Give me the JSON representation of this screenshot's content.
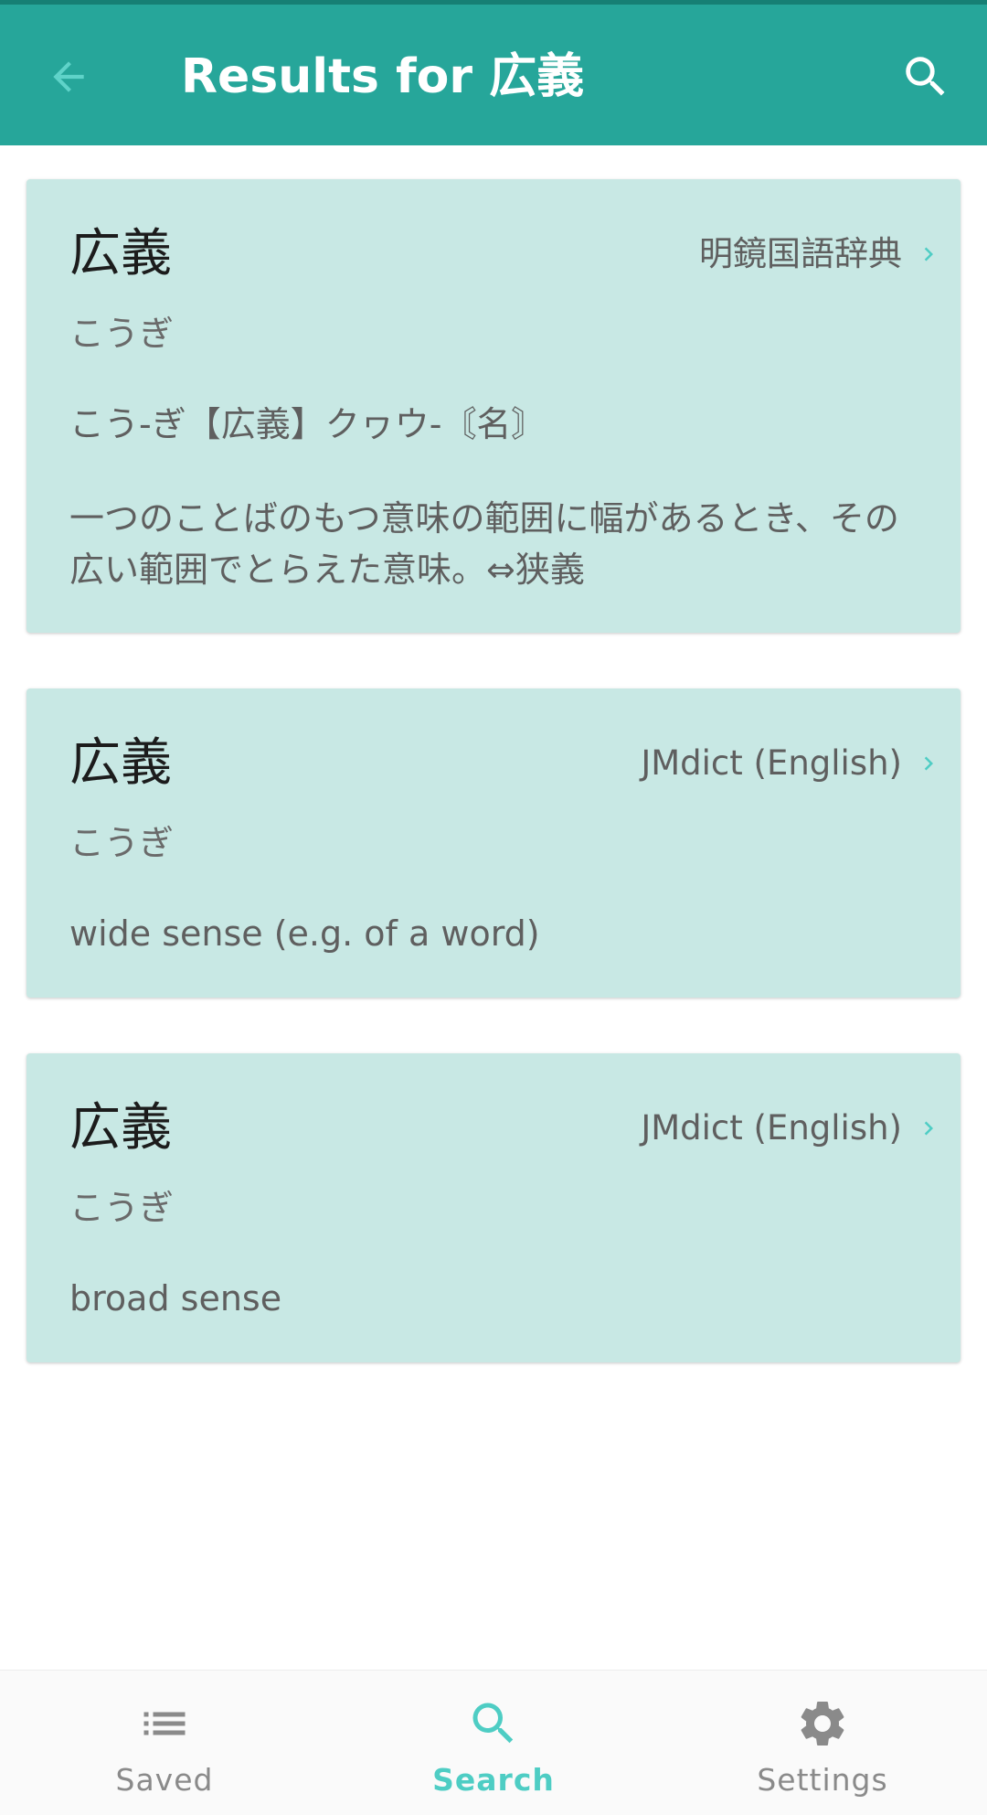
{
  "app_bar": {
    "title": "Results for 広義"
  },
  "colors": {
    "app_bar": "#26a69a",
    "status_strip": "#167f74",
    "accent": "#4ecdc4",
    "card_bg": "#c8e8e4",
    "inactive_nav": "#8a8a8a"
  },
  "icons": {
    "back": "arrow-back-icon",
    "search": "search-icon",
    "chevron": "chevron-right-icon",
    "saved": "list-icon",
    "settings": "gear-icon"
  },
  "results": [
    {
      "headword": "広義",
      "source": "明鏡国語辞典",
      "reading": "こうぎ",
      "definition_lines": [
        "こう‐ぎ【広義】クヮウ‐〘名〙",
        "一つのことばのもつ意味の範囲に幅があるとき、その広い範囲でとらえた意味。⇔狭義"
      ]
    },
    {
      "headword": "広義",
      "source": "JMdict (English)",
      "reading": "こうぎ",
      "definition_lines": [
        "wide sense (e.g. of a word)"
      ]
    },
    {
      "headword": "広義",
      "source": "JMdict (English)",
      "reading": "こうぎ",
      "definition_lines": [
        "broad sense"
      ]
    }
  ],
  "bottom_nav": {
    "items": [
      {
        "label": "Saved",
        "active": false
      },
      {
        "label": "Search",
        "active": true
      },
      {
        "label": "Settings",
        "active": false
      }
    ]
  }
}
